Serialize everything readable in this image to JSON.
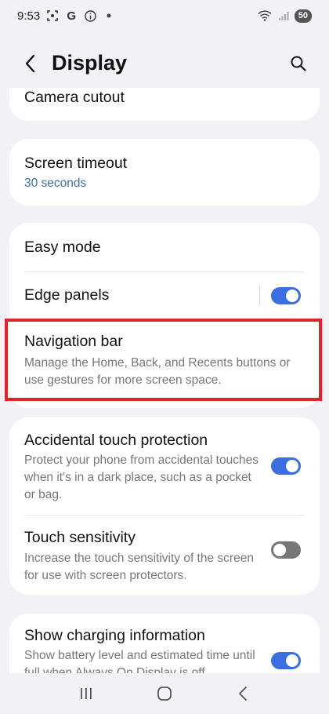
{
  "status_bar": {
    "time": "9:53",
    "battery": "50"
  },
  "app_bar": {
    "title": "Display"
  },
  "settings": {
    "camera_cutout": {
      "title": "Camera cutout"
    },
    "screen_timeout": {
      "title": "Screen timeout",
      "value": "30 seconds"
    },
    "easy_mode": {
      "title": "Easy mode"
    },
    "edge_panels": {
      "title": "Edge panels",
      "enabled": true
    },
    "navigation_bar": {
      "title": "Navigation bar",
      "subtitle": "Manage the Home, Back, and Recents buttons or use gestures for more screen space."
    },
    "accidental_touch": {
      "title": "Accidental touch protection",
      "subtitle": "Protect your phone from accidental touches when it's in a dark place, such as a pocket or bag.",
      "enabled": true
    },
    "touch_sensitivity": {
      "title": "Touch sensitivity",
      "subtitle": "Increase the touch sensitivity of the screen for use with screen protectors.",
      "enabled": false
    },
    "charging_info": {
      "title": "Show charging information",
      "subtitle": "Show battery level and estimated time until full when Always On Display is off.",
      "enabled": true
    }
  },
  "colors": {
    "accent": "#3b6fe0",
    "highlight": "#e0242c",
    "background": "#f2f1f6"
  }
}
